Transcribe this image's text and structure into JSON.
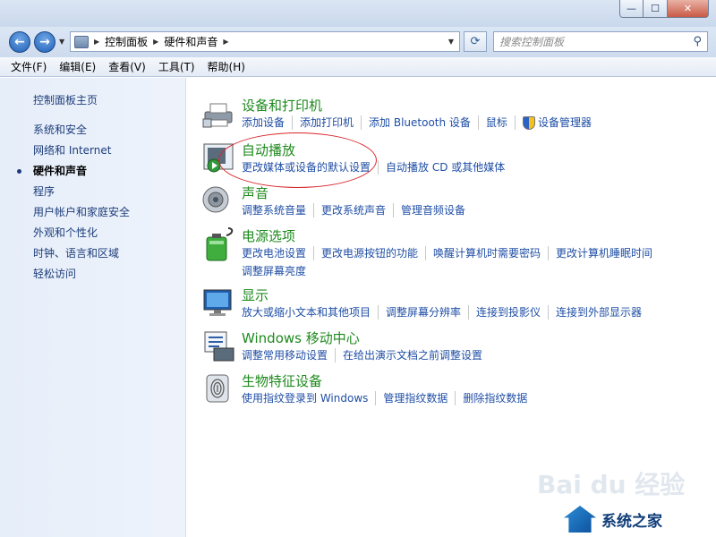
{
  "window": {
    "caption_buttons": {
      "minimize": "—",
      "maximize": "☐",
      "close": "✕"
    }
  },
  "nav": {
    "back_glyph": "←",
    "forward_glyph": "→",
    "breadcrumbs": [
      "控制面板",
      "硬件和声音"
    ],
    "refresh_glyph": "⟳",
    "search_placeholder": "搜索控制面板",
    "search_glyph": "⚲"
  },
  "menu": [
    "文件(F)",
    "编辑(E)",
    "查看(V)",
    "工具(T)",
    "帮助(H)"
  ],
  "sidebar": {
    "home": "控制面板主页",
    "items": [
      {
        "label": "系统和安全",
        "active": false
      },
      {
        "label": "网络和 Internet",
        "active": false
      },
      {
        "label": "硬件和声音",
        "active": true
      },
      {
        "label": "程序",
        "active": false
      },
      {
        "label": "用户帐户和家庭安全",
        "active": false
      },
      {
        "label": "外观和个性化",
        "active": false
      },
      {
        "label": "时钟、语言和区域",
        "active": false
      },
      {
        "label": "轻松访问",
        "active": false
      }
    ]
  },
  "categories": [
    {
      "title": "设备和打印机",
      "icon": "printer-icon",
      "links": [
        "添加设备",
        "添加打印机",
        "添加 Bluetooth 设备",
        "鼠标",
        "设备管理器"
      ]
    },
    {
      "title": "自动播放",
      "icon": "autoplay-icon",
      "links": [
        "更改媒体或设备的默认设置",
        "自动播放 CD 或其他媒体"
      ]
    },
    {
      "title": "声音",
      "icon": "speaker-icon",
      "links": [
        "调整系统音量",
        "更改系统声音",
        "管理音频设备"
      ]
    },
    {
      "title": "电源选项",
      "icon": "battery-icon",
      "links": [
        "更改电池设置",
        "更改电源按钮的功能",
        "唤醒计算机时需要密码",
        "更改计算机睡眠时间",
        "调整屏幕亮度"
      ]
    },
    {
      "title": "显示",
      "icon": "monitor-icon",
      "links": [
        "放大或缩小文本和其他项目",
        "调整屏幕分辨率",
        "连接到投影仪",
        "连接到外部显示器"
      ]
    },
    {
      "title": "Windows 移动中心",
      "icon": "mobility-center-icon",
      "links": [
        "调整常用移动设置",
        "在给出演示文档之前调整设置"
      ]
    },
    {
      "title": "生物特征设备",
      "icon": "fingerprint-icon",
      "links": [
        "使用指纹登录到 Windows",
        "管理指纹数据",
        "删除指纹数据"
      ]
    }
  ],
  "watermark": {
    "text": "Bai du 经验",
    "site": "系统之家"
  },
  "colors": {
    "title_green": "#1d8a1d",
    "link_blue": "#1f4ea5",
    "highlight_red": "#d9252a"
  }
}
